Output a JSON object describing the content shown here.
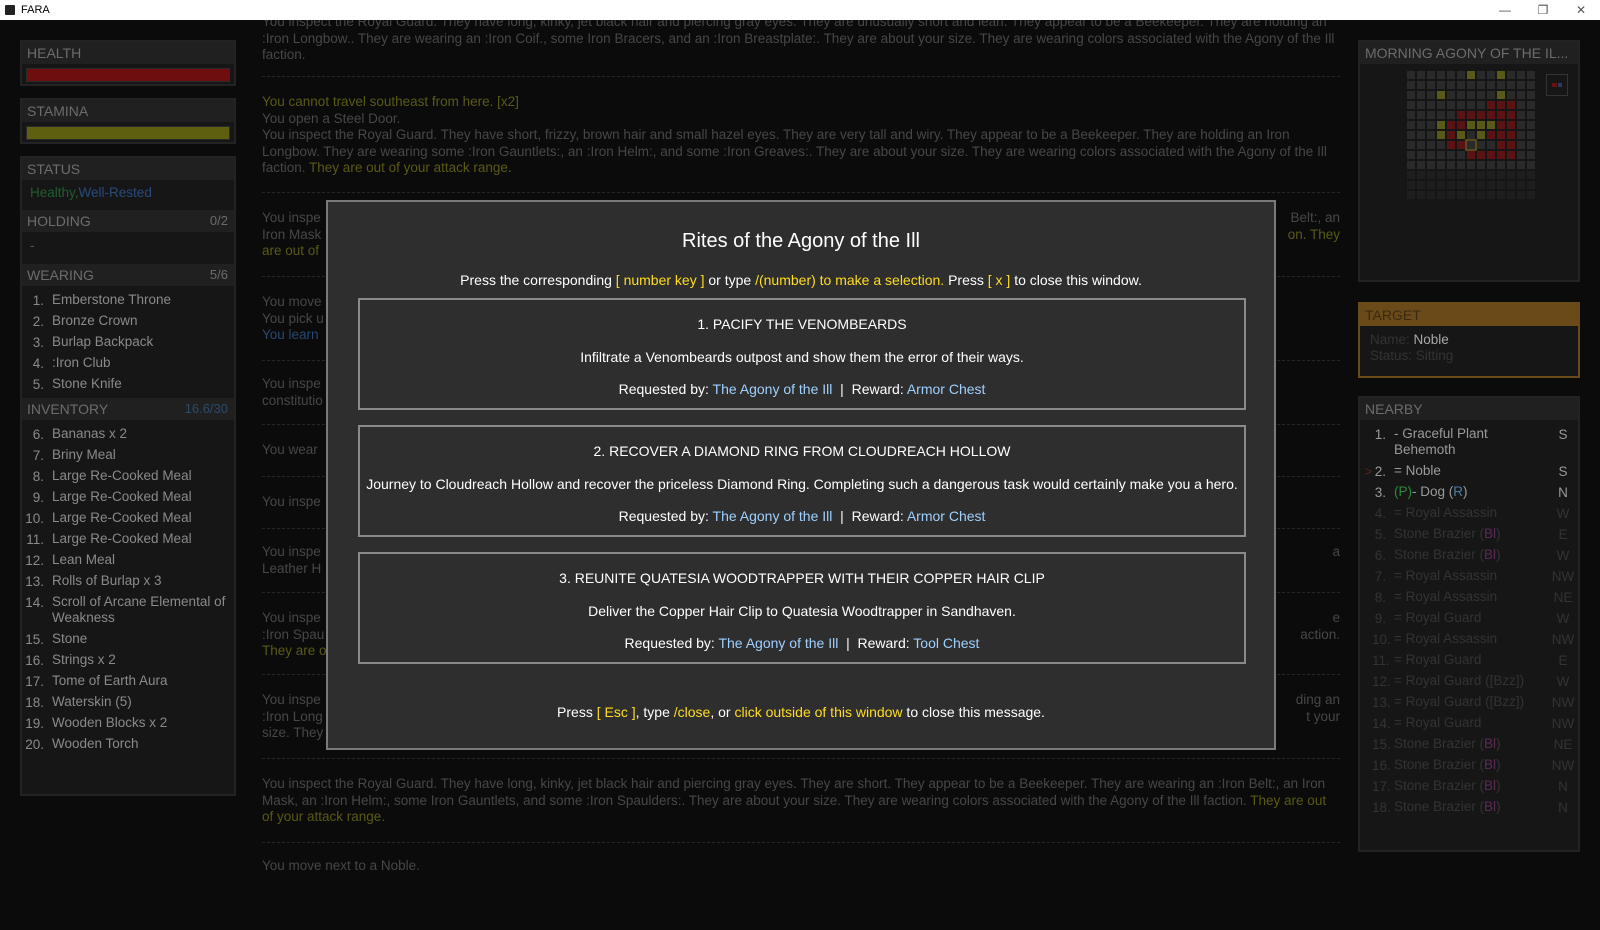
{
  "window": {
    "title": "FARA"
  },
  "health": {
    "label": "HEALTH",
    "color": "#6e0e0e",
    "fill": 1.0
  },
  "stamina": {
    "label": "STAMINA",
    "color": "#5f5f10",
    "fill": 1.0
  },
  "status": {
    "label": "STATUS",
    "healthy": "Healthy",
    "sep": ",",
    "rested": "Well-Rested"
  },
  "holding": {
    "label": "HOLDING",
    "count": "0/2",
    "value": "-"
  },
  "wearing": {
    "label": "WEARING",
    "count": "5/6",
    "items": [
      {
        "num": "1.",
        "name": "Emberstone Throne"
      },
      {
        "num": "2.",
        "name": "Bronze Crown"
      },
      {
        "num": "3.",
        "name": "Burlap Backpack"
      },
      {
        "num": "4.",
        "name": ":Iron Club"
      },
      {
        "num": "5.",
        "name": "Stone Knife"
      }
    ]
  },
  "inventory": {
    "label": "INVENTORY",
    "count": "16.6/30",
    "items": [
      {
        "num": "6.",
        "name": "Bananas x 2"
      },
      {
        "num": "7.",
        "name": "Briny Meal"
      },
      {
        "num": "8.",
        "name": "Large Re-Cooked Meal"
      },
      {
        "num": "9.",
        "name": "Large Re-Cooked Meal"
      },
      {
        "num": "10.",
        "name": "Large Re-Cooked Meal"
      },
      {
        "num": "11.",
        "name": "Large Re-Cooked Meal"
      },
      {
        "num": "12.",
        "name": "Lean Meal"
      },
      {
        "num": "13.",
        "name": "Rolls of Burlap x 3"
      },
      {
        "num": "14.",
        "name": "Scroll of Arcane Elemental of Weakness"
      },
      {
        "num": "15.",
        "name": "Stone"
      },
      {
        "num": "16.",
        "name": "Strings x 2"
      },
      {
        "num": "17.",
        "name": "Tome of Earth Aura"
      },
      {
        "num": "18.",
        "name": "Waterskin (5)"
      },
      {
        "num": "19.",
        "name": "Wooden Blocks x 2"
      },
      {
        "num": "20.",
        "name": "Wooden Torch"
      }
    ]
  },
  "log": {
    "e1": "You inspect the Royal Guard. They have long, kinky, jet black hair and piercing gray eyes. They are unusually short and lean. They appear to be a Beekeeper. They are holding an :Iron Longbow.. They are wearing an :Iron Coif., some Iron Bracers, and an :Iron Breastplate:. They are about your size. They are wearing colors associated with the Agony of the Ill faction.",
    "e2a": "You cannot travel southeast from here. [x2]",
    "e2b": "You open a Steel Door.",
    "e2c": "You inspect the Royal Guard. They have short, frizzy, brown hair and small hazel eyes. They are very tall and wiry. They appear to be a Beekeeper. They are holding an Iron Longbow. They are wearing some :Iron Gauntlets:, an :Iron Helm:, and some :Iron Greaves:. They are about your size. They are wearing colors associated with the Agony of the Ill faction.",
    "e2d": "They are out of your attack range.",
    "e3a": "You inspe",
    "e3b": "Iron Mask",
    "e3c": "are out of",
    "e3r1": "Belt:, an",
    "e3r2": "on. They",
    "e4a": "You move",
    "e4b": "You pick u",
    "e4c": "You learn",
    "e5a": "You inspe",
    "e5b": "constitutio",
    "e6": "You wear",
    "e7": "You inspe",
    "e8a": "You inspe",
    "e8b": "Leather H",
    "e8r": "a",
    "e9a": "You inspe",
    "e9b": ":Iron Spau",
    "e9c": "They are o",
    "e9r1": "e",
    "e9r2": "action.",
    "e10a": "You inspe",
    "e10b": ":Iron Long",
    "e10c": "size. They",
    "e10r1": "ding an",
    "e10r2": "t your",
    "e11": "You inspect the Royal Guard. They have long, kinky, jet black hair and piercing gray eyes. They are short. They appear to be a Beekeeper. They are wearing an :Iron Belt:, an Iron Mask, an :Iron Helm:, some Iron Gauntlets, and some :Iron Spaulders:. They are about your size. They are wearing colors associated with the Agony of the Ill faction.",
    "e11y": "They are out of your attack range.",
    "e12": "You move next to a Noble."
  },
  "map": {
    "label": "MORNING   AGONY OF THE IL..."
  },
  "target": {
    "label": "TARGET",
    "name_label": "Name:",
    "name": "Noble",
    "status_label": "Status:",
    "status": "Sitting"
  },
  "nearby": {
    "label": "NEARBY",
    "items": [
      {
        "num": "1.",
        "name": "- Graceful Plant Behemoth",
        "dir": "S"
      },
      {
        "num": "2.",
        "name": "= Noble",
        "dir": "S",
        "cursor": ">"
      },
      {
        "num": "3.",
        "pre": "(P)",
        "name": "- Dog (",
        "tag": "R",
        "post": ")",
        "dir": "N"
      },
      {
        "num": "4.",
        "name": "= Royal Assassin",
        "dir": "W"
      },
      {
        "num": "5.",
        "name": "Stone Brazier (",
        "tag": "Bl",
        "post": ")",
        "dir": "E"
      },
      {
        "num": "6.",
        "name": "Stone Brazier (",
        "tag": "Bl",
        "post": ")",
        "dir": "W"
      },
      {
        "num": "7.",
        "name": "= Royal Assassin",
        "dir": "NW"
      },
      {
        "num": "8.",
        "name": "= Royal Assassin",
        "dir": "NE"
      },
      {
        "num": "9.",
        "name": "= Royal Guard",
        "dir": "W"
      },
      {
        "num": "10.",
        "name": "= Royal Assassin",
        "dir": "NW"
      },
      {
        "num": "11.",
        "name": "= Royal Guard",
        "dir": "E"
      },
      {
        "num": "12.",
        "name": "= Royal Guard ([Bzz])",
        "dir": "W"
      },
      {
        "num": "13.",
        "name": "= Royal Guard ([Bzz])",
        "dir": "NW"
      },
      {
        "num": "14.",
        "name": "= Royal Guard",
        "dir": "NW"
      },
      {
        "num": "15.",
        "name": "Stone Brazier (",
        "tag": "Bl",
        "post": ")",
        "dir": "NE"
      },
      {
        "num": "16.",
        "name": "Stone Brazier (",
        "tag": "Bl",
        "post": ")",
        "dir": "NW"
      },
      {
        "num": "17.",
        "name": "Stone Brazier (",
        "tag": "Bl",
        "post": ")",
        "dir": "N"
      },
      {
        "num": "18.",
        "name": "Stone Brazier (",
        "tag": "Bl",
        "post": ")",
        "dir": "N"
      }
    ]
  },
  "modal": {
    "title": "Rites of the Agony of the Ill",
    "instr_1": "Press the corresponding ",
    "instr_key": "[ number key ]",
    "instr_2": " or type ",
    "instr_cmd": "/(number) to make a selection.",
    "instr_3": " Press ",
    "instr_x": "[ x ]",
    "instr_4": " to close this window.",
    "requested_label": "Requested by: ",
    "reward_label": "Reward: ",
    "pipe": "|",
    "quests": [
      {
        "title": "1. PACIFY THE VENOMBEARDS",
        "desc": "Infiltrate a Venombeards outpost and show them the error of their ways.",
        "by": "The Agony of the Ill",
        "reward": "Armor Chest"
      },
      {
        "title": "2. RECOVER A DIAMOND RING FROM CLOUDREACH HOLLOW",
        "desc": "Journey to Cloudreach Hollow and recover the priceless Diamond Ring. Completing such a dangerous task would certainly make you a hero.",
        "by": "The Agony of the Ill",
        "reward": "Armor Chest"
      },
      {
        "title": "3. REUNITE QUATESIA WOODTRAPPER WITH THEIR COPPER HAIR CLIP",
        "desc": "Deliver the Copper Hair Clip to Quatesia Woodtrapper in Sandhaven.",
        "by": "The Agony of the Ill",
        "reward": "Tool Chest"
      }
    ],
    "footer_1": "Press ",
    "footer_esc": "[ Esc ]",
    "footer_2": ", type ",
    "footer_close": "/close",
    "footer_3": ", or ",
    "footer_click": "click outside of this window",
    "footer_4": " to close this message."
  },
  "colors": {
    "accent_yellow": "#ffdd22",
    "link_blue": "#9fd0ff",
    "healthy_green": "#1f5f2f",
    "rested_blue": "#2a4a7a"
  }
}
